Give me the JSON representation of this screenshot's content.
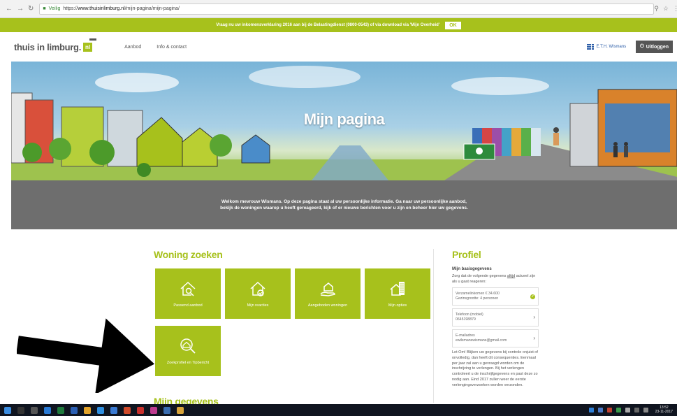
{
  "browser": {
    "secure_label": "Veilig",
    "url_prefix": "https://",
    "url_host": "www.thuisinlimburg.nl",
    "url_path": "/mijn-pagina/mijn-pagina/"
  },
  "notice": {
    "text": "Vraag nu uw inkomensverklaring 2016 aan bij de Belastingdienst (0800-0543) of via download via 'Mijn Overheid'",
    "ok_label": "OK"
  },
  "header": {
    "logo_text": "thuis in limburg.",
    "logo_badge": "nl",
    "nav": [
      "Aanbod",
      "Info & contact"
    ],
    "user_name": "E.T.H. Wismans",
    "login_label": "Uitloggen"
  },
  "hero": {
    "title": "Mijn pagina",
    "welcome": "Welkom mevrouw Wismans. Op deze pagina staat al uw persoonlijke informatie. Ga naar uw persoonlijke aanbod, bekijk de woningen waarop u heeft gereageerd, kijk of er nieuwe berichten voor u zijn en beheer hier uw gegevens."
  },
  "woning_zoeken": {
    "title": "Woning zoeken",
    "tiles": [
      {
        "label": "Passend aanbod",
        "icon": "house-search-icon"
      },
      {
        "label": "Mijn reacties",
        "icon": "house-check-icon"
      },
      {
        "label": "Aangeboden woningen",
        "icon": "house-offer-icon"
      },
      {
        "label": "Mijn opties",
        "icon": "building-icon"
      },
      {
        "label": "Zoekprofiel en Tipbericht",
        "icon": "search-profile-icon"
      }
    ]
  },
  "mijn_gegevens": {
    "title": "Mijn gegevens"
  },
  "profile": {
    "title": "Profiel",
    "subtitle": "Mijn basisgegevens",
    "intro_a": "Zorg dat de volgende gegevens ",
    "intro_link": "altijd",
    "intro_b": " actueel zijn als u gaat reageren:",
    "cards": [
      {
        "line1": "Verzamelinkomen € 34.600",
        "line2": "Gezinsgrootte: 4 personen",
        "icon": "check-icon"
      },
      {
        "line1": "Telefoon (mobiel)",
        "line2": "0645198879",
        "icon": "chevron-right-icon"
      },
      {
        "line1": "E-mailadres",
        "line2": "ewilsmanswismans@gmail.com",
        "icon": "chevron-right-icon"
      }
    ],
    "note": "Let Om! Blijken uw gegevens bij controle onjuist of onvolledig, dan heeft dit consequenties. Eenmaal per jaar zal aan u gevraagd worden om de inschrijving te verlengen. Bij het verlengen controleert u de inschrijfgegevens en past deze zo nodig aan. Eind 2017 zullen weer de eerste verlengingsverzoeken worden verzonden."
  },
  "taskbar": {
    "time": "13:52",
    "date": "23-11-2017"
  },
  "colors": {
    "brand_green": "#a7c11c",
    "band_grey": "#6e6e6e",
    "link_blue": "#2d5ea8"
  }
}
